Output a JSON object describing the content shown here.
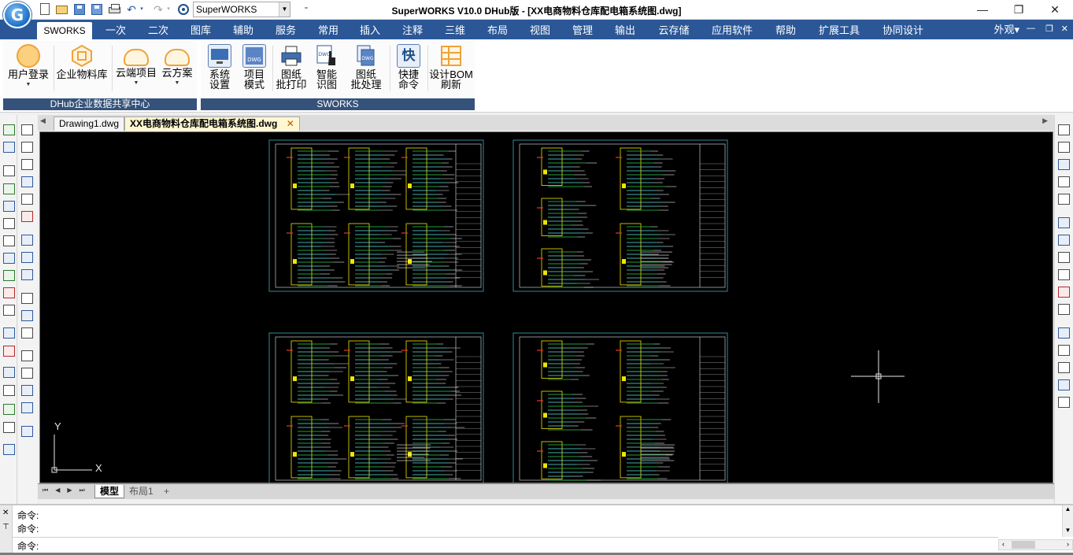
{
  "window": {
    "title": "SuperWORKS V10.0 DHub版 - [XX电商物料仓库配电箱系统图.dwg]",
    "logo_letter": "G",
    "workspace_select": "SuperWORKS",
    "controls": {
      "minimize": "—",
      "maximize": "❐",
      "close": "✕"
    }
  },
  "ribbon_tabs": [
    "SWORKS",
    "一次",
    "二次",
    "图库",
    "辅助",
    "服务",
    "常用",
    "插入",
    "注释",
    "三维",
    "布局",
    "视图",
    "管理",
    "输出",
    "云存储",
    "应用软件",
    "帮助",
    "扩展工具",
    "协同设计"
  ],
  "appearance_menu": "外观▾",
  "ribbon": {
    "groups": [
      {
        "label": "DHub企业数据共享中心",
        "buttons": [
          {
            "line1": "用户登录",
            "line2": ""
          },
          {
            "line1": "企业物料库",
            "line2": ""
          },
          {
            "line1": "云端项目",
            "line2": ""
          },
          {
            "line1": "云方案",
            "line2": ""
          }
        ]
      },
      {
        "label": "SWORKS",
        "buttons": [
          {
            "line1": "系统",
            "line2": "设置"
          },
          {
            "line1": "项目",
            "line2": "模式"
          },
          {
            "line1": "图纸",
            "line2": "批打印"
          },
          {
            "line1": "智能",
            "line2": "识图"
          },
          {
            "line1": "图纸",
            "line2": "批处理"
          },
          {
            "line1": "快捷",
            "line2": "命令"
          },
          {
            "line1": "设计BOM",
            "line2": "刷新"
          }
        ]
      }
    ],
    "icon_labels": {
      "dwg": "DWG",
      "quick": "快"
    }
  },
  "document_tabs": [
    "Drawing1.dwg",
    "XX电商物料仓库配电箱系统图.dwg"
  ],
  "layout_tabs": [
    "模型",
    "布局1",
    "+"
  ],
  "ucs": {
    "x": "X",
    "y": "Y"
  },
  "command": {
    "history": [
      "命令:",
      "命令:"
    ],
    "prompt": "命令:"
  },
  "colors": {
    "tab_bar": "#2b5797",
    "group_label": "#35527a",
    "canvas_bg": "#000000",
    "cad_frame": "#2e8b9a",
    "cad_white": "#e8e8e8",
    "cad_yellow": "#f2e600",
    "cad_cyan": "#5fe0e0",
    "cad_green": "#2fd04a",
    "cad_red": "#e23a2a"
  }
}
